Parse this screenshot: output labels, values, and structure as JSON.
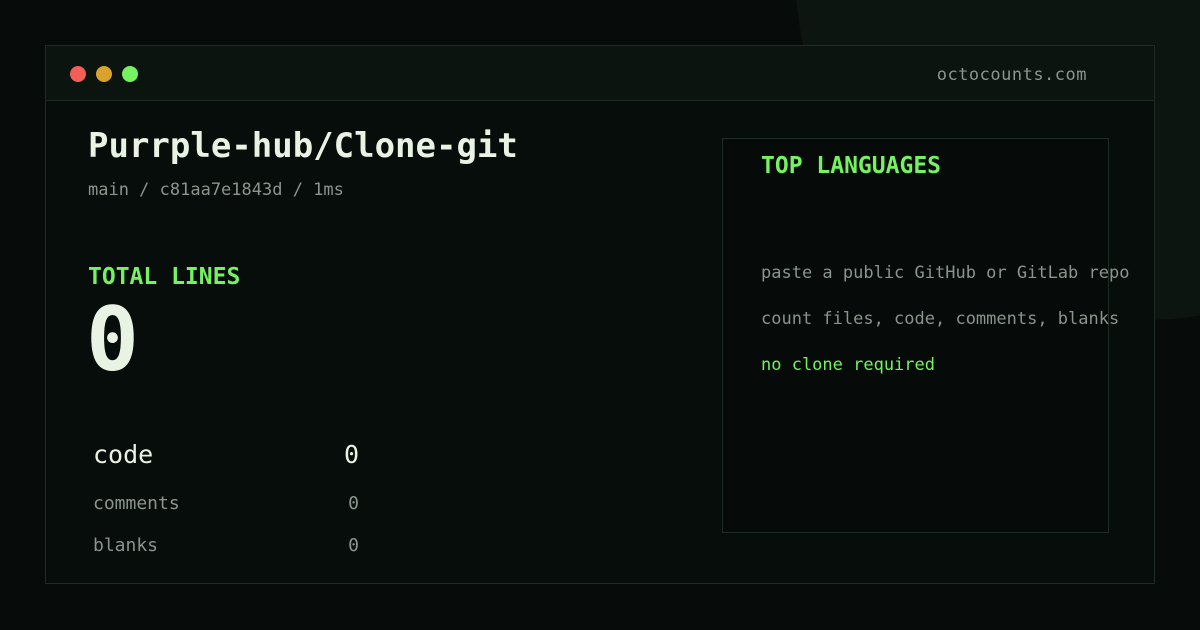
{
  "window": {
    "site": "octocounts.com",
    "controls": [
      "close",
      "minimize",
      "maximize"
    ]
  },
  "repo": {
    "title": "Purrple-hub/Clone-git",
    "meta": "main / c81aa7e1843d / 1ms"
  },
  "totals": {
    "label": "TOTAL LINES",
    "value": "0"
  },
  "stats": [
    {
      "label": "code",
      "value": "0"
    },
    {
      "label": "comments",
      "value": "0"
    },
    {
      "label": "blanks",
      "value": "0"
    }
  ],
  "languages": {
    "title": "TOP LANGUAGES",
    "lines": [
      "paste a public GitHub or GitLab repo",
      "count files, code, comments, blanks",
      "no clone required"
    ]
  },
  "colors": {
    "accent": "#74f25f",
    "background": "#070b09",
    "text": "#e9f3e4",
    "muted": "#8a958e",
    "dot_red": "#f25f57",
    "dot_yellow": "#d9a22a",
    "dot_green": "#74f25f"
  }
}
